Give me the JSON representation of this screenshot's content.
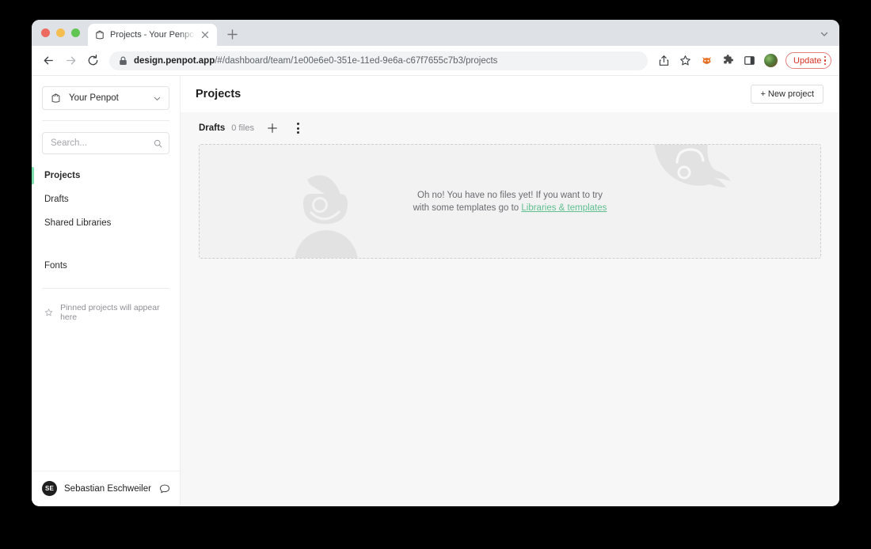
{
  "browser": {
    "tab": {
      "title": "Projects - Your Penpot - Penpo",
      "favicon_name": "penpot-favicon",
      "close_label": "×"
    },
    "new_tab_label": "+",
    "toolbar": {
      "back_label": "←",
      "forward_label": "→",
      "reload_label": "⟳",
      "url_bold": "design.penpot.app",
      "url_rest": "/#/dashboard/team/1e00e6e0-351e-11ed-9e6a-c67f7655c7b3/projects",
      "url_full": "design.penpot.app/#/dashboard/team/1e00e6e0-351e-11ed-9e6a-c67f7655c7b3/projects",
      "update_label": "Update",
      "icons": [
        "share-icon",
        "bookmark-star-icon",
        "firefox-extension-icon",
        "extensions-puzzle-icon",
        "side-panel-icon",
        "profile-avatar"
      ]
    }
  },
  "sidebar": {
    "team": {
      "name": "Your Penpot",
      "chevron": "⌄"
    },
    "search": {
      "value": "",
      "placeholder": "Search..."
    },
    "items": [
      {
        "label": "Projects",
        "active": true
      },
      {
        "label": "Drafts",
        "active": false
      },
      {
        "label": "Shared Libraries",
        "active": false
      },
      {
        "label": "Fonts",
        "active": false
      }
    ],
    "pinned_hint": "Pinned projects will appear here",
    "profile": {
      "initials": "SE",
      "name": "Sebastian Eschweiler"
    }
  },
  "main": {
    "title": "Projects",
    "new_project_label": "+ New project",
    "project": {
      "name": "Drafts",
      "files_count": "0 files",
      "add_label": "+"
    },
    "empty_state": {
      "line1": "Oh no! You have no files yet! If you want to try",
      "line2_prefix": "with some templates go to ",
      "link": "Libraries & templates"
    }
  },
  "colors": {
    "accent_green": "#7ee0ac",
    "link_green": "#5fbf8f",
    "update_red": "#d93025",
    "app_bg": "#f7f7f8",
    "dropzone_bg": "#f2f2f3",
    "deco_gray": "#e2e2e3"
  }
}
